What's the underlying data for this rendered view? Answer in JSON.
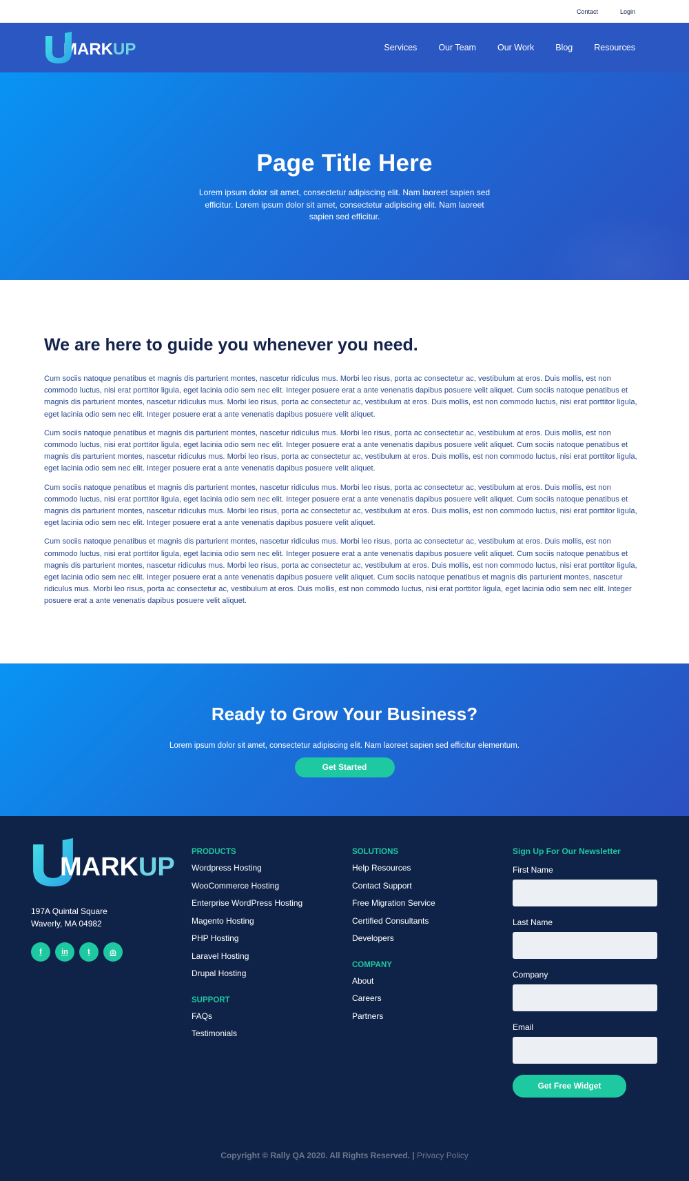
{
  "utility": {
    "contact": "Contact",
    "login": "Login"
  },
  "brand": {
    "part1": "MARK",
    "part2": "UP"
  },
  "nav": {
    "items": [
      "Services",
      "Our Team",
      "Our Work",
      "Blog",
      "Resources"
    ]
  },
  "hero": {
    "title": "Page Title Here",
    "subtitle": "Lorem ipsum dolor sit amet, consectetur adipiscing elit. Nam laoreet sapien sed efficitur. Lorem ipsum dolor sit amet, consectetur adipiscing elit. Nam laoreet sapien sed efficitur."
  },
  "content": {
    "heading": "We are here to guide you whenever you need.",
    "paragraphs": [
      "Cum sociis natoque penatibus et magnis dis parturient montes, nascetur ridiculus mus. Morbi leo risus, porta ac consectetur ac, vestibulum at eros. Duis mollis, est non commodo luctus, nisi erat porttitor ligula, eget lacinia odio sem nec elit. Integer posuere erat a ante venenatis dapibus posuere velit aliquet. Cum sociis natoque penatibus et magnis dis parturient montes, nascetur ridiculus mus. Morbi leo risus, porta ac consectetur ac, vestibulum at eros. Duis mollis, est non commodo luctus, nisi erat porttitor ligula, eget lacinia odio sem nec elit. Integer posuere erat a ante venenatis dapibus posuere velit aliquet.",
      "Cum sociis natoque penatibus et magnis dis parturient montes, nascetur ridiculus mus. Morbi leo risus, porta ac consectetur ac, vestibulum at eros. Duis mollis, est non commodo luctus, nisi erat porttitor ligula, eget lacinia odio sem nec elit. Integer posuere erat a ante venenatis dapibus posuere velit aliquet. Cum sociis natoque penatibus et magnis dis parturient montes, nascetur ridiculus mus. Morbi leo risus, porta ac consectetur ac, vestibulum at eros. Duis mollis, est non commodo luctus, nisi erat porttitor ligula, eget lacinia odio sem nec elit. Integer posuere erat a ante venenatis dapibus posuere velit aliquet.",
      "Cum sociis natoque penatibus et magnis dis parturient montes, nascetur ridiculus mus. Morbi leo risus, porta ac consectetur ac, vestibulum at eros. Duis mollis, est non commodo luctus, nisi erat porttitor ligula, eget lacinia odio sem nec elit. Integer posuere erat a ante venenatis dapibus posuere velit aliquet. Cum sociis natoque penatibus et magnis dis parturient montes, nascetur ridiculus mus. Morbi leo risus, porta ac consectetur ac, vestibulum at eros. Duis mollis, est non commodo luctus, nisi erat porttitor ligula, eget lacinia odio sem nec elit. Integer posuere erat a ante venenatis dapibus posuere velit aliquet.",
      "Cum sociis natoque penatibus et magnis dis parturient montes, nascetur ridiculus mus. Morbi leo risus, porta ac consectetur ac, vestibulum at eros. Duis mollis, est non commodo luctus, nisi erat porttitor ligula, eget lacinia odio sem nec elit. Integer posuere erat a ante venenatis dapibus posuere velit aliquet. Cum sociis natoque penatibus et magnis dis parturient montes, nascetur ridiculus mus. Morbi leo risus, porta ac consectetur ac, vestibulum at eros. Duis mollis, est non commodo luctus, nisi erat porttitor ligula, eget lacinia odio sem nec elit. Integer posuere erat a ante venenatis dapibus posuere velit aliquet. Cum sociis natoque penatibus et magnis dis parturient montes, nascetur ridiculus mus. Morbi leo risus, porta ac consectetur ac, vestibulum at eros. Duis mollis, est non commodo luctus, nisi erat porttitor ligula, eget lacinia odio sem nec elit. Integer posuere erat a ante venenatis dapibus posuere velit aliquet."
    ]
  },
  "cta": {
    "title": "Ready to Grow Your Business?",
    "text": "Lorem ipsum dolor sit amet, consectetur adipiscing elit. Nam laoreet sapien sed efficitur elementum.",
    "button": "Get Started"
  },
  "footer": {
    "address_line1": "197A Quintal Square",
    "address_line2": "Waverly, MA 04982",
    "socials": [
      {
        "icon": "facebook-icon",
        "glyph": "f"
      },
      {
        "icon": "linkedin-icon",
        "glyph": "in"
      },
      {
        "icon": "twitter-icon",
        "glyph": "t"
      },
      {
        "icon": "instagram-icon",
        "glyph": "◎"
      }
    ],
    "products": {
      "heading": "PRODUCTS",
      "links": [
        "Wordpress Hosting",
        "WooCommerce Hosting",
        "Enterprise WordPress Hosting",
        "Magento Hosting",
        "PHP Hosting",
        "Laravel Hosting",
        "Drupal Hosting"
      ]
    },
    "support": {
      "heading": "SUPPORT",
      "links": [
        "FAQs",
        "Testimonials"
      ]
    },
    "solutions": {
      "heading": "SOLUTIONS",
      "links": [
        "Help Resources",
        "Contact Support",
        "Free Migration Service",
        "Certified Consultants",
        "Developers"
      ]
    },
    "company": {
      "heading": "COMPANY",
      "links": [
        "About",
        "Careers",
        "Partners"
      ]
    },
    "newsletter": {
      "title": "Sign Up For Our Newsletter",
      "fields": [
        "First Name",
        "Last Name",
        "Company",
        "Email"
      ],
      "button": "Get Free Widget"
    },
    "copyright": "Copyright © Rally QA 2020. All Rights Reserved. |",
    "privacy": "Privacy Policy"
  },
  "colors": {
    "nav": "#2a57c1",
    "accent": "#1ec8a0",
    "footer": "#0f2348",
    "logo_accent": "#6fd3e3"
  }
}
